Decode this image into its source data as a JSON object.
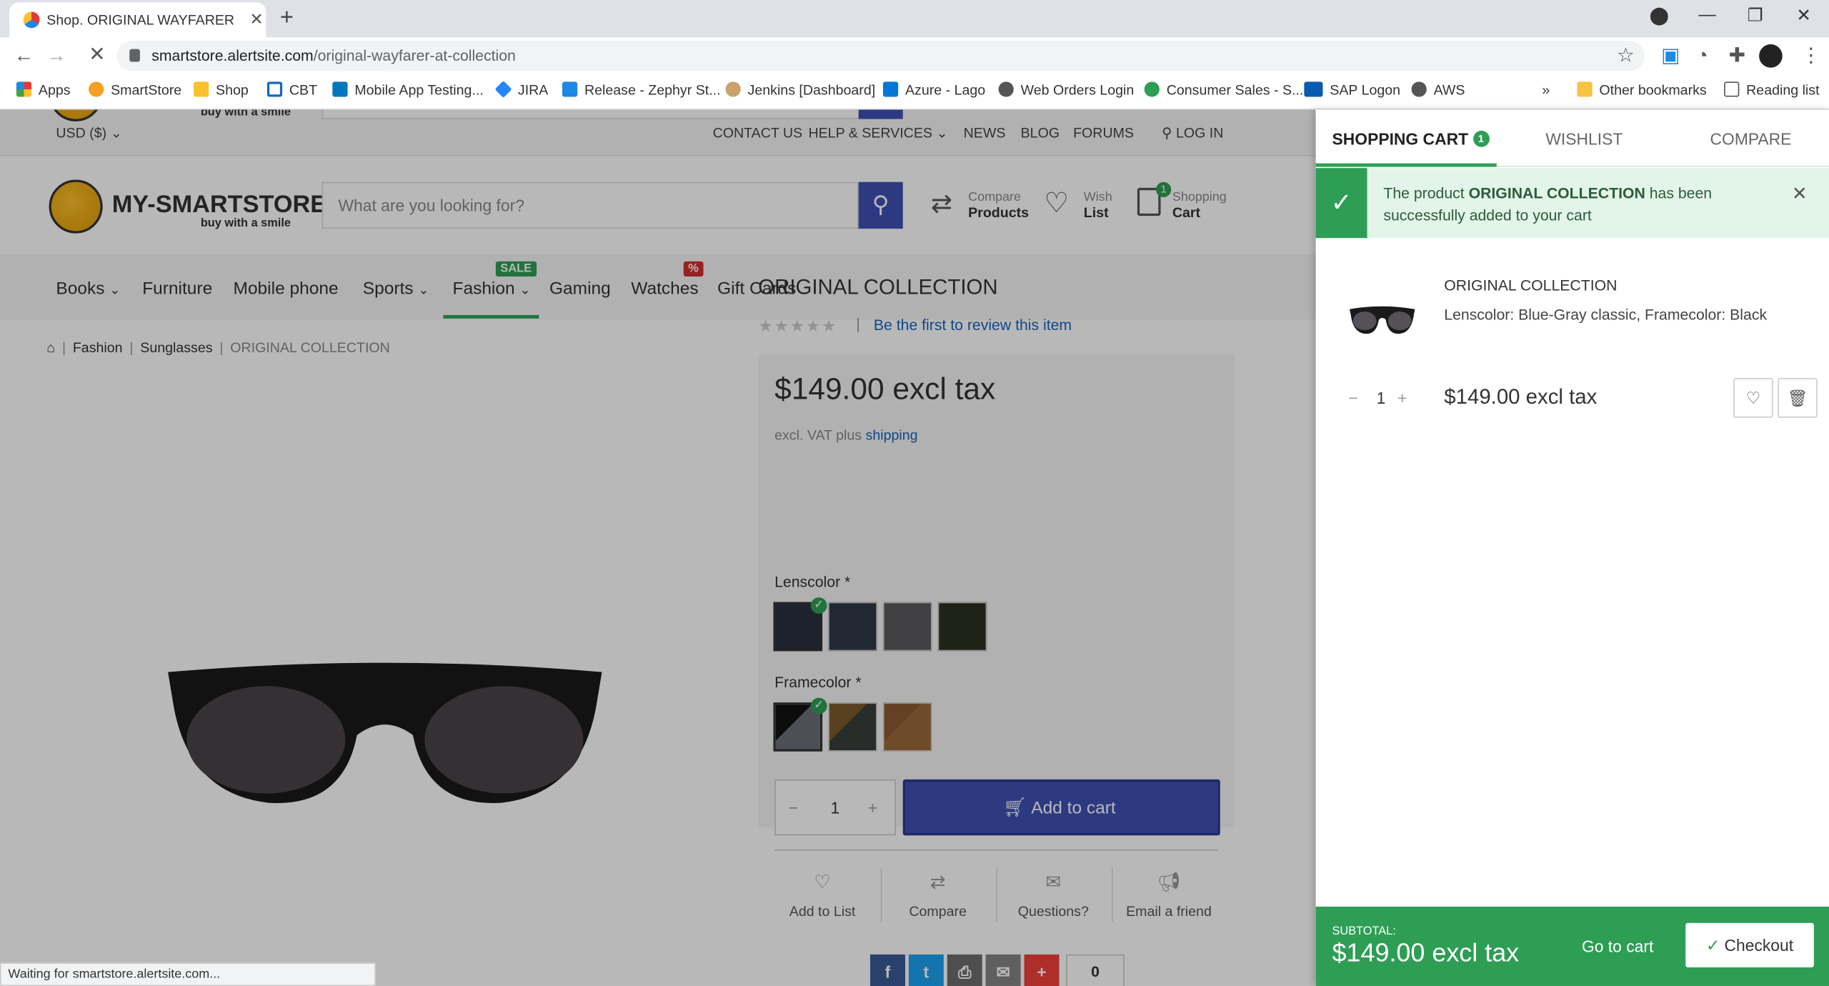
{
  "browser": {
    "tab_title": "Shop. ORIGINAL WAYFARER AT C",
    "url_domain": "smartstore.alertsite.com",
    "url_path": "/original-wayfarer-at-collection",
    "bookmarks": [
      "Apps",
      "SmartStore",
      "Shop",
      "CBT",
      "Mobile App Testing...",
      "JIRA",
      "Release - Zephyr St...",
      "Jenkins [Dashboard]",
      "Azure - Lago",
      "Web Orders Login",
      "Consumer Sales - S...",
      "SAP Logon",
      "AWS",
      "»",
      "Other bookmarks",
      "Reading list"
    ],
    "status": "Waiting for smartstore.alertsite.com..."
  },
  "topbar": {
    "currency": "USD ($)",
    "links": [
      "CONTACT US",
      "HELP & SERVICES",
      "NEWS",
      "BLOG",
      "FORUMS",
      "LOG IN"
    ]
  },
  "header": {
    "logo_text": "MY-SMARTSTORE",
    "logo_tagline": "buy with a smile",
    "search_placeholder": "What are you looking for?",
    "compare_top": "Compare",
    "compare_bottom": "Products",
    "wish_top": "Wish",
    "wish_bottom": "List",
    "cart_top": "Shopping",
    "cart_bottom": "Cart",
    "cart_count": "1"
  },
  "menu": {
    "items": [
      "Books",
      "Furniture",
      "Mobile phone",
      "Sports",
      "Fashion",
      "Gaming",
      "Watches",
      "Gift Cards"
    ],
    "sale_badge": "SALE",
    "percent_badge": "%"
  },
  "breadcrumb": [
    "Fashion",
    "Sunglasses",
    "ORIGINAL COLLECTION"
  ],
  "product": {
    "title": "ORIGINAL COLLECTION",
    "stars": "★★★★★",
    "review_link": "Be the first to review this item",
    "price": "$149.00 excl tax",
    "vat_prefix": "excl. VAT plus",
    "vat_link": "shipping",
    "lens_label": "Lenscolor *",
    "frame_label": "Framecolor *",
    "qty": "1",
    "add_to_cart": "Add to cart",
    "actions": [
      "Add to List",
      "Compare",
      "Questions?",
      "Email a friend"
    ],
    "share_count": "0"
  },
  "sidebar": {
    "tabs": [
      "SHOPPING CART",
      "WISHLIST",
      "COMPARE"
    ],
    "tab_count": "1",
    "notice_pre": "The product",
    "notice_bold": "ORIGINAL COLLECTION",
    "notice_post": "has been successfully added to your cart",
    "item_title": "ORIGINAL COLLECTION",
    "item_attrs": "Lenscolor: Blue-Gray classic, Framecolor: Black",
    "item_qty": "1",
    "item_price": "$149.00 excl tax",
    "subtotal_label": "SUBTOTAL:",
    "subtotal_value": "$149.00 excl tax",
    "go_to_cart": "Go to cart",
    "checkout": "Checkout"
  },
  "colors": {
    "accent_blue": "#3f51b5",
    "success_green": "#2e9e55",
    "link_blue": "#1565c0"
  }
}
